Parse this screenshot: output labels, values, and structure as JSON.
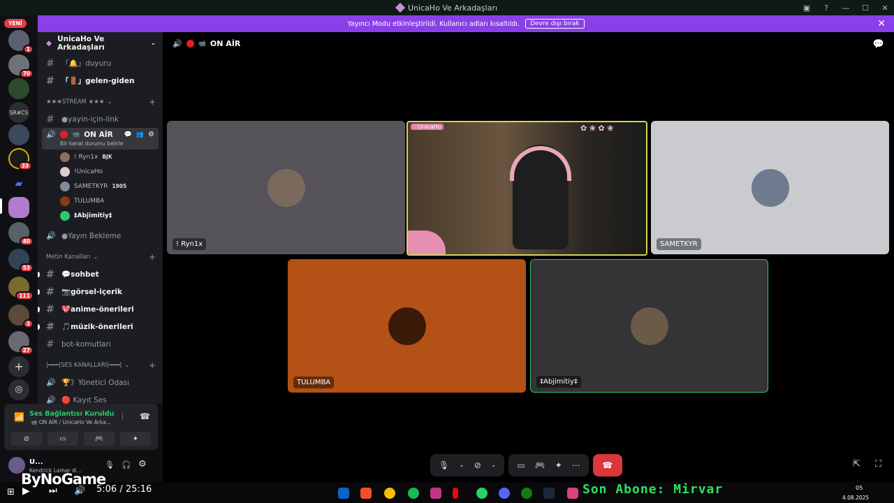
{
  "window": {
    "title": "UnicaHo Ve Arkadaşları"
  },
  "banner": {
    "message": "Yayıncı Modu etkinleştirildi. Kullanıcı adları kısaltıldı.",
    "button": "Devre dışı bırak"
  },
  "serverbar": {
    "new_label": "YENİ",
    "text_icon": "SR#CS",
    "badges": [
      "1",
      "70",
      "33",
      "40",
      "53",
      "111",
      "3",
      "27"
    ]
  },
  "server": {
    "name": "UnicaHo Ve Arkadaşları",
    "channels_top": [
      {
        "label": "「🔔」duyuru"
      },
      {
        "label": "「🚪」gelen-giden"
      }
    ],
    "stream_category": "★★★STREAM ★★★",
    "stream_text_channel": "●yayin-için-link",
    "active_voice": {
      "name": "ON AİR",
      "status": "Bir kanal durumu belirle",
      "users": [
        {
          "name": "! Ryn1x",
          "tag": "BJK"
        },
        {
          "name": "!UnicaHo",
          "tag": ""
        },
        {
          "name": "SAMETKYR",
          "tag": "1905"
        },
        {
          "name": "TULUMBA",
          "tag": ""
        },
        {
          "name": "‡Abjimitiy‡",
          "tag": ""
        }
      ]
    },
    "waiting_channel": "●Yayın Bekleme",
    "text_category": "Metin Kanalları",
    "text_channels": [
      {
        "label": "💬sohbet"
      },
      {
        "label": "📷görsel-içerik"
      },
      {
        "label": "💖anime-önerileri"
      },
      {
        "label": "🎵müzik-önerileri"
      },
      {
        "label": "bot-komutları"
      }
    ],
    "voice_category": "|━━━|SES KANALLARI|━━━|",
    "voice_channels": [
      {
        "label": "🏆》Yönetici Odası"
      },
      {
        "label": "🔴 Kayıt Ses"
      }
    ]
  },
  "voice_panel": {
    "title": "Ses Bağlantısı Kuruldu",
    "subtitle": "📹 ON AİR / UnicaHo Ve Arka..."
  },
  "user_panel": {
    "name": "U...",
    "status": "Kendrick Lamar di..."
  },
  "stage": {
    "channel_name": "ON AİR",
    "tiles": [
      {
        "name": "! Ryn1x"
      },
      {
        "name": ""
      },
      {
        "name": "SAMETKYR"
      },
      {
        "name": "TULUMBA"
      },
      {
        "name": "‡Abjimitiy‡"
      }
    ],
    "camera_overlay": "♡UnicaHo"
  },
  "player": {
    "time": "5:06 / 25:16",
    "ticker": "Son Abone: Mirvar",
    "watermark": "ByNoGame",
    "date": "4.08.2025",
    "clock_partial": "05"
  },
  "colors": {
    "banner": "#8a40e8",
    "speaking_green": "#2dc770",
    "end_call": "#da373c",
    "tulumba_tile": "#b45116",
    "sametkyr_tile": "#c9cbcf"
  }
}
